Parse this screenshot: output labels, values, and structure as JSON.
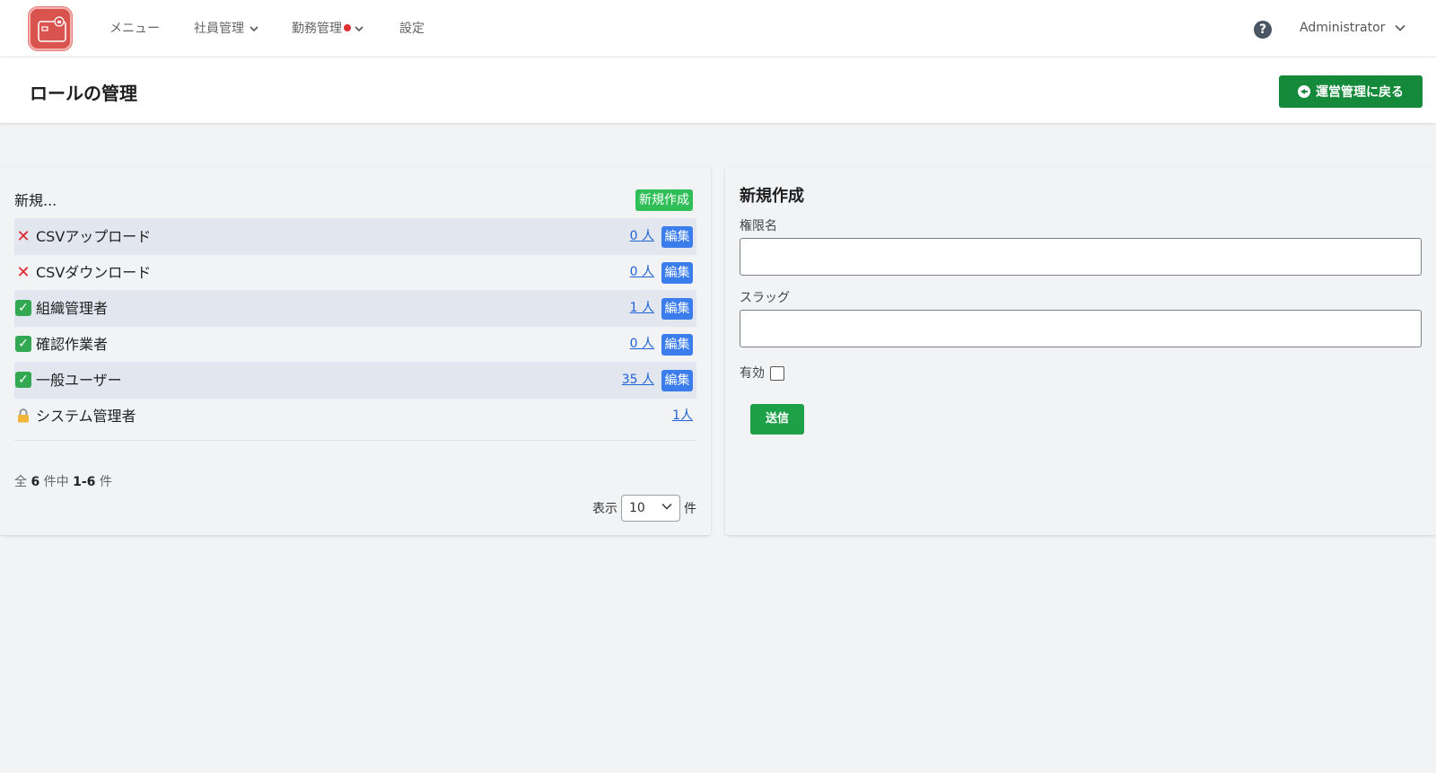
{
  "nav": {
    "items": [
      {
        "label": "メニュー"
      },
      {
        "label": "社員管理"
      },
      {
        "label": "勤務管理"
      },
      {
        "label": "設定"
      }
    ],
    "help_glyph": "?",
    "user": "Administrator"
  },
  "header": {
    "title": "ロールの管理",
    "back_button": "運営管理に戻る"
  },
  "roles": {
    "new_row_label": "新規...",
    "new_button": "新規作成",
    "edit_label": "編集",
    "items": [
      {
        "status": "disabled",
        "name": "CSVアップロード",
        "count": "0 人",
        "editable": true
      },
      {
        "status": "enabled",
        "name": "CSVダウンロード",
        "count": "0 人",
        "editable": true
      },
      {
        "status": "enabled",
        "name": "組織管理者",
        "count": "1 人",
        "editable": true
      },
      {
        "status": "enabled",
        "name": "確認作業者",
        "count": "0 人",
        "editable": true
      },
      {
        "status": "enabled",
        "name": "一般ユーザー",
        "count": "35 人",
        "editable": true
      },
      {
        "status": "locked",
        "name": "システム管理者",
        "count": "1人",
        "editable": false
      }
    ],
    "summary": {
      "prefix": "全",
      "total": "6",
      "mid": "件中",
      "range": "1-6",
      "suffix": "件"
    },
    "perpage": {
      "prefix": "表示",
      "value": "10",
      "suffix": "件"
    }
  },
  "form": {
    "title": "新規作成",
    "name_label": "権限名",
    "name_value": "",
    "slug_label": "スラッグ",
    "slug_value": "",
    "active_label": "有効",
    "active_checked": false,
    "submit": "送信"
  },
  "colors": {
    "accent_green": "#158a3a",
    "edit_blue": "#3b7ded",
    "new_green": "#2fbe57",
    "link_blue": "#1f62d6",
    "status_red": "#e0242c"
  }
}
